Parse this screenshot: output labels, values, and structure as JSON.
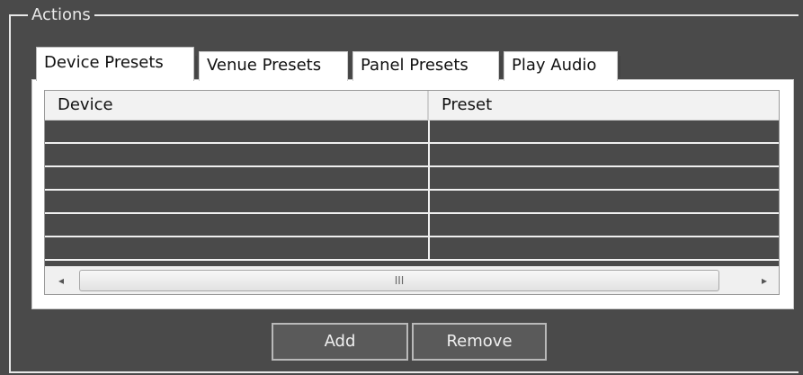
{
  "groupbox": {
    "title": "Actions"
  },
  "tabs": [
    {
      "label": "Device Presets",
      "active": true
    },
    {
      "label": "Venue Presets",
      "active": false
    },
    {
      "label": "Panel Presets",
      "active": false
    },
    {
      "label": "Play Audio",
      "active": false
    }
  ],
  "table": {
    "columns": [
      "Device",
      "Preset"
    ],
    "rows": [
      [
        "",
        ""
      ],
      [
        "",
        ""
      ],
      [
        "",
        ""
      ],
      [
        "",
        ""
      ],
      [
        "",
        ""
      ],
      [
        "",
        ""
      ]
    ]
  },
  "scrollbar": {
    "left_arrow": "◂",
    "right_arrow": "▸",
    "thumb_grip": "III"
  },
  "buttons": {
    "add_label": "Add",
    "remove_label": "Remove"
  }
}
